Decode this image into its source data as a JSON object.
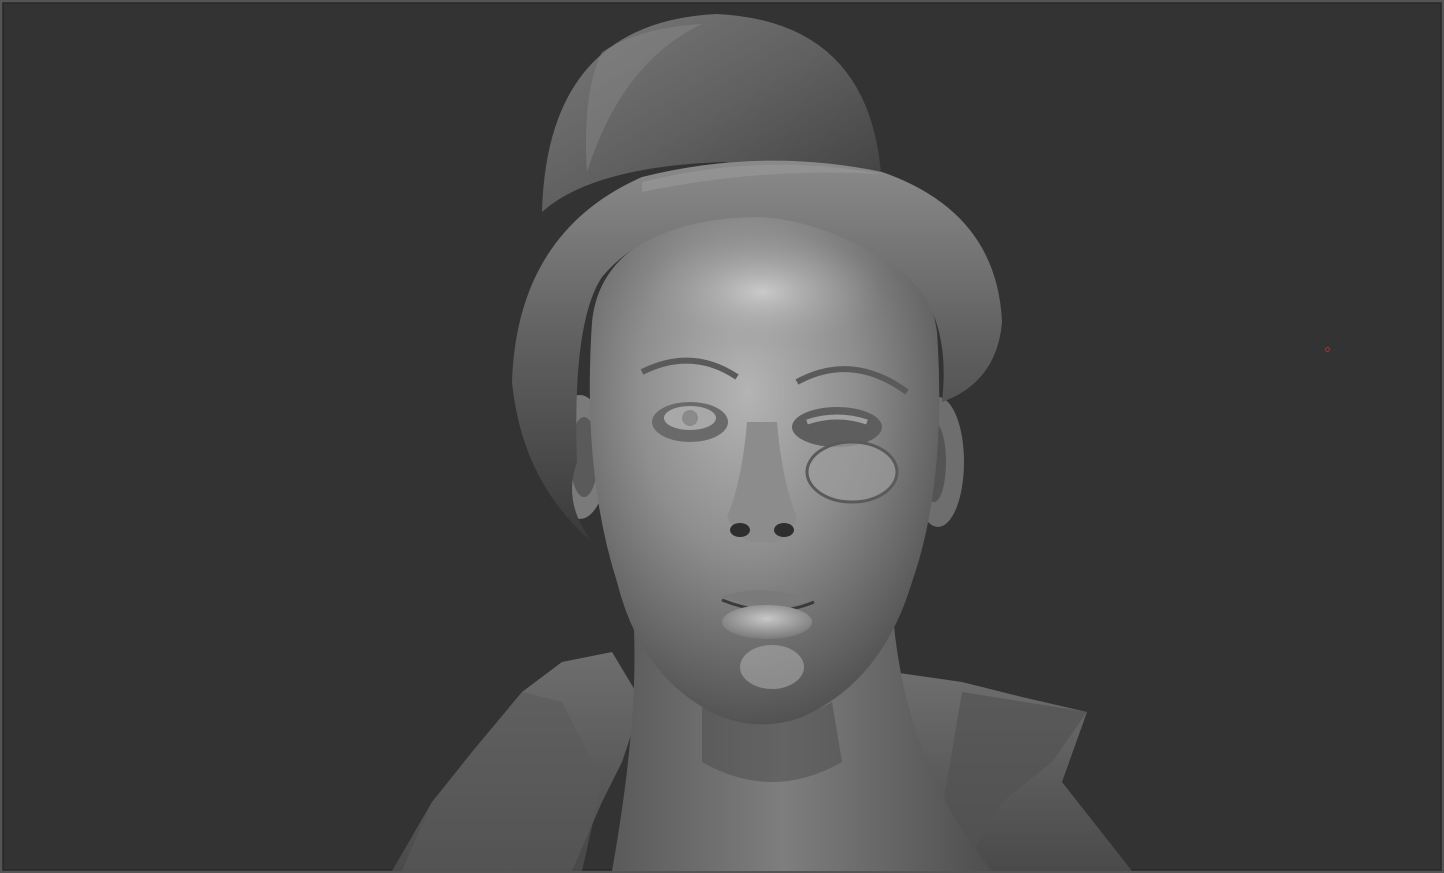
{
  "viewport": {
    "background_color": "#333333",
    "border_color": "#555555",
    "material_color": "#8a8a8a"
  },
  "model": {
    "parts": [
      "top-hat",
      "head",
      "face",
      "ears",
      "neck",
      "coat-collar"
    ]
  },
  "cursor": {
    "color": "#d02020"
  }
}
